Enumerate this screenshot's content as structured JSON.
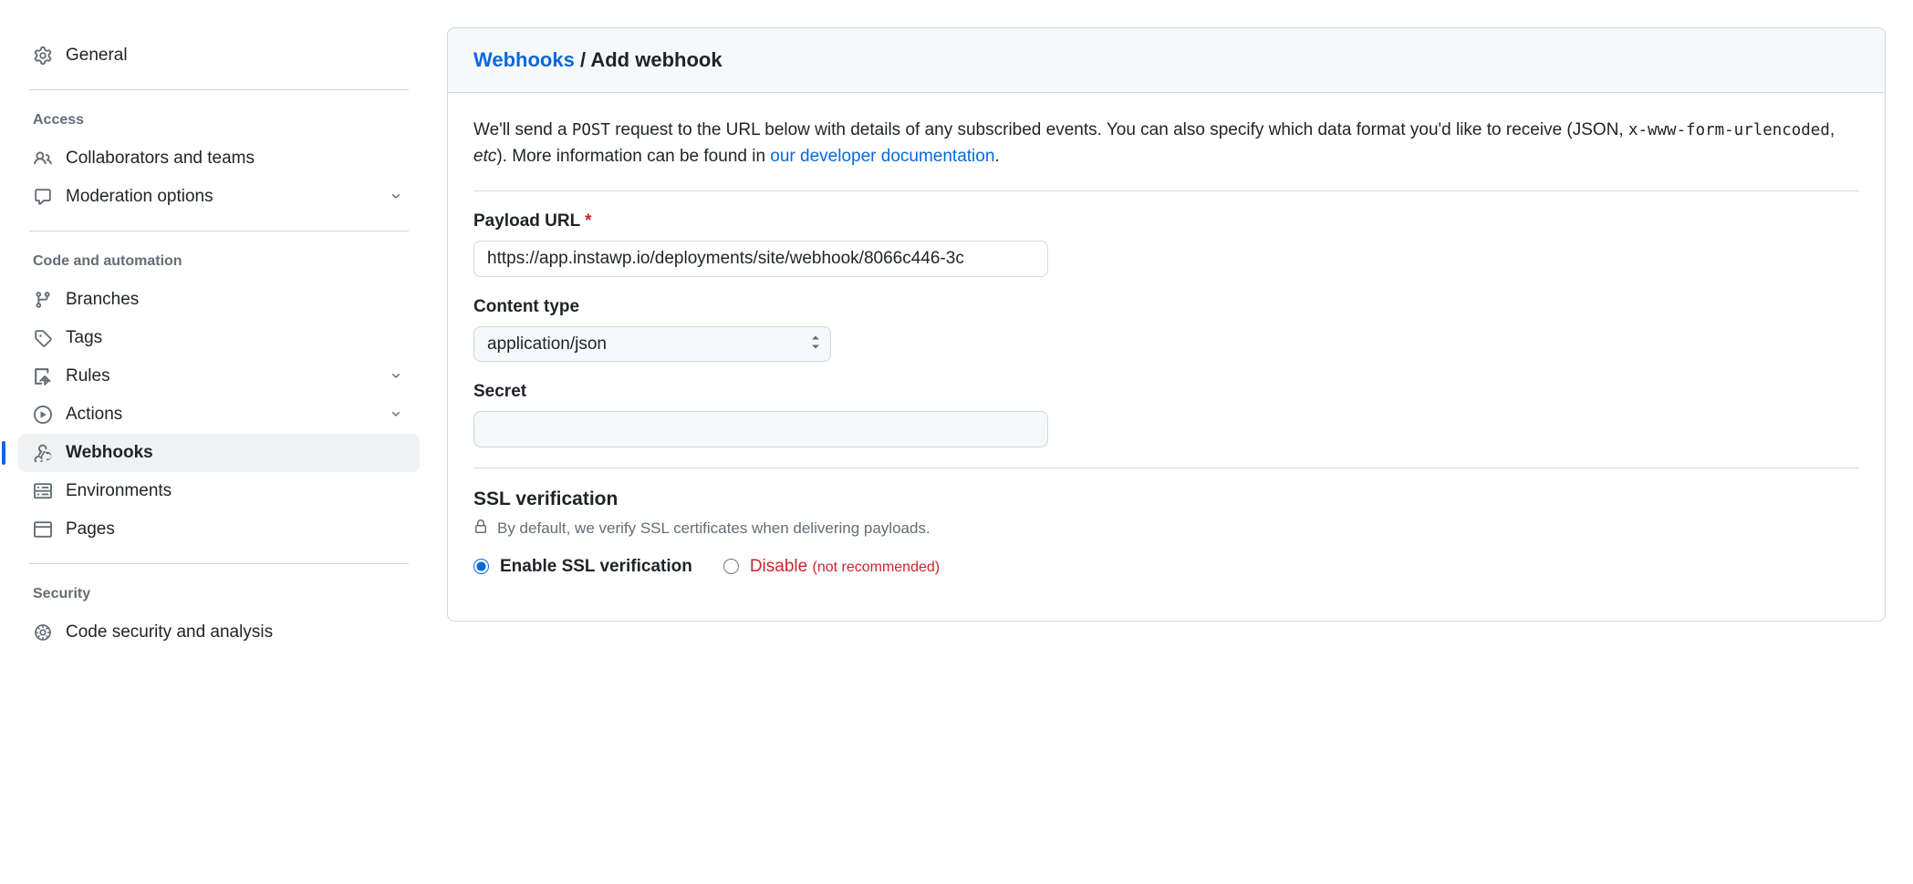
{
  "sidebar": {
    "general": "General",
    "sections": {
      "access": {
        "heading": "Access",
        "items": [
          {
            "label": "Collaborators and teams"
          },
          {
            "label": "Moderation options"
          }
        ]
      },
      "code": {
        "heading": "Code and automation",
        "items": [
          {
            "label": "Branches"
          },
          {
            "label": "Tags"
          },
          {
            "label": "Rules"
          },
          {
            "label": "Actions"
          },
          {
            "label": "Webhooks"
          },
          {
            "label": "Environments"
          },
          {
            "label": "Pages"
          }
        ]
      },
      "security": {
        "heading": "Security",
        "items": [
          {
            "label": "Code security and analysis"
          }
        ]
      }
    }
  },
  "breadcrumb": {
    "root": "Webhooks",
    "sep": " / ",
    "current": "Add webhook"
  },
  "intro": {
    "p1a": "We'll send a ",
    "p1_code1": "POST",
    "p1b": " request to the URL below with details of any subscribed events. You can also specify which data format you'd like to receive (JSON, ",
    "p1_code2": "x-www-form-urlencoded",
    "p1c": ", ",
    "p1_em": "etc",
    "p1d": "). More information can be found in ",
    "link": "our developer documentation",
    "p1e": "."
  },
  "form": {
    "payload_label": "Payload URL",
    "payload_required": "*",
    "payload_value": "https://app.instawp.io/deployments/site/webhook/8066c446-3c",
    "content_type_label": "Content type",
    "content_type_value": "application/json",
    "secret_label": "Secret",
    "secret_value": "",
    "ssl_heading": "SSL verification",
    "ssl_note": "By default, we verify SSL certificates when delivering payloads.",
    "ssl_enable": "Enable SSL verification",
    "ssl_disable": "Disable ",
    "ssl_disable_note": "(not recommended)"
  }
}
